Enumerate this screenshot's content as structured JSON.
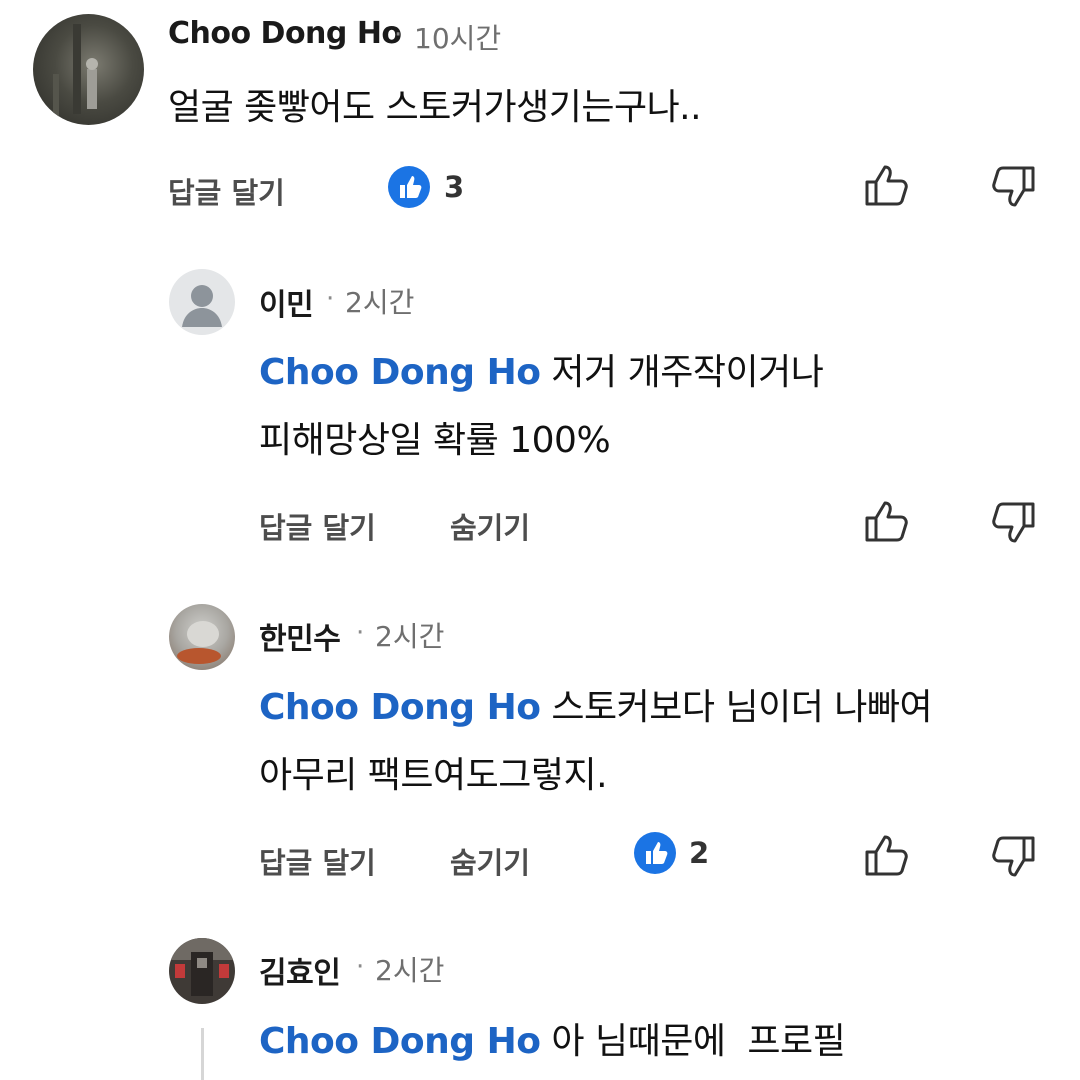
{
  "comments": [
    {
      "author": "Choo Dong Ho",
      "separator": "·",
      "time": "10시간",
      "text": "얼굴 좆빻어도 스토커가생기는구나..",
      "reply_label": "답글 달기",
      "likes": "3"
    },
    {
      "author": "이민",
      "separator": "·",
      "time": "2시간",
      "mention": "Choo Dong Ho",
      "text_line1": "저거 개주작이거나",
      "text_line2": "피해망상일 확률 100%",
      "reply_label": "답글 달기",
      "hide_label": "숨기기"
    },
    {
      "author": "한민수",
      "separator": "·",
      "time": "2시간",
      "mention": "Choo Dong Ho",
      "text_line1": "스토커보다 님이더 나빠여",
      "text_line2": "아무리 팩트여도그렇지.",
      "reply_label": "답글 달기",
      "hide_label": "숨기기",
      "likes": "2"
    },
    {
      "author": "김효인",
      "separator": "·",
      "time": "2시간",
      "mention": "Choo Dong Ho",
      "text_line1": "아 님때문에  프로필"
    }
  ],
  "colors": {
    "mention": "#1d64c4",
    "like_badge": "#1b74e4"
  },
  "icons": {
    "like_badge": "thumbs-up-filled",
    "like": "thumbs-up-outline",
    "dislike": "thumbs-down-outline"
  }
}
